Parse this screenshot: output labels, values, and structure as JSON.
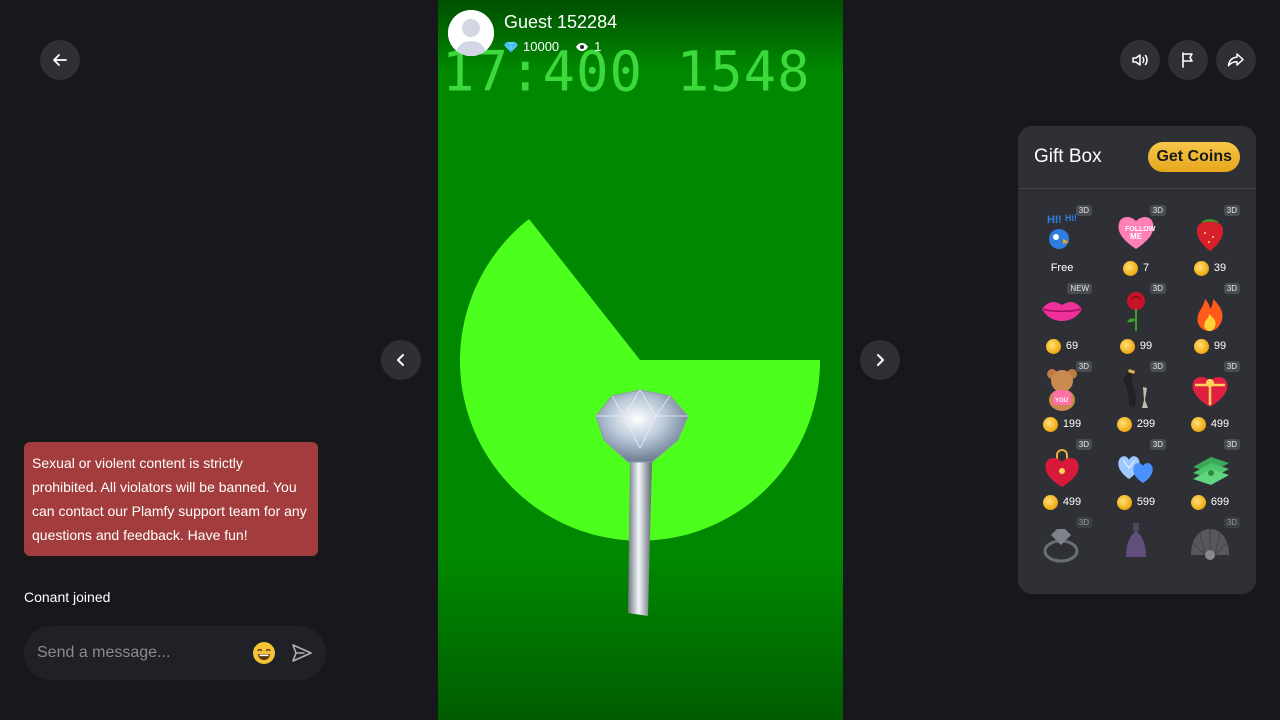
{
  "host": {
    "name": "Guest 152284",
    "diamonds": "10000",
    "viewers": "1"
  },
  "stream": {
    "overlay_text": "17:400 1548"
  },
  "chat": {
    "notice": "Sexual or violent content is strictly prohibited. All violators will be banned. You can contact our Plamfy support team for any questions and feedback. Have fun!",
    "joined": "Conant joined",
    "placeholder": "Send a message..."
  },
  "giftbox": {
    "title": "Gift Box",
    "get_coins_label": "Get Coins",
    "gifts": [
      {
        "icon": "hi-parrot-icon",
        "tag": "3D",
        "price": "Free",
        "free": true
      },
      {
        "icon": "follow-me-heart-icon",
        "tag": "3D",
        "price": "7"
      },
      {
        "icon": "strawberry-icon",
        "tag": "3D",
        "price": "39"
      },
      {
        "icon": "lips-icon",
        "tag": "NEW",
        "price": "69"
      },
      {
        "icon": "rose-icon",
        "tag": "3D",
        "price": "99"
      },
      {
        "icon": "fire-icon",
        "tag": "3D",
        "price": "99"
      },
      {
        "icon": "teddy-bear-icon",
        "tag": "3D",
        "price": "199"
      },
      {
        "icon": "champagne-icon",
        "tag": "3D",
        "price": "299"
      },
      {
        "icon": "chocolate-box-icon",
        "tag": "3D",
        "price": "499"
      },
      {
        "icon": "heart-lock-icon",
        "tag": "3D",
        "price": "499"
      },
      {
        "icon": "diamond-hearts-icon",
        "tag": "3D",
        "price": "599"
      },
      {
        "icon": "money-stack-icon",
        "tag": "3D",
        "price": "699"
      },
      {
        "icon": "ring-icon",
        "tag": "3D",
        "price": ""
      },
      {
        "icon": "perfume-icon",
        "tag": "",
        "price": ""
      },
      {
        "icon": "pearl-shell-icon",
        "tag": "3D",
        "price": ""
      }
    ]
  },
  "colors": {
    "background": "#17181b",
    "notice": "#a33c3c",
    "accent_gold": "#f2b01b",
    "stream_green": "#008800",
    "pie_green": "#4dff1c"
  }
}
